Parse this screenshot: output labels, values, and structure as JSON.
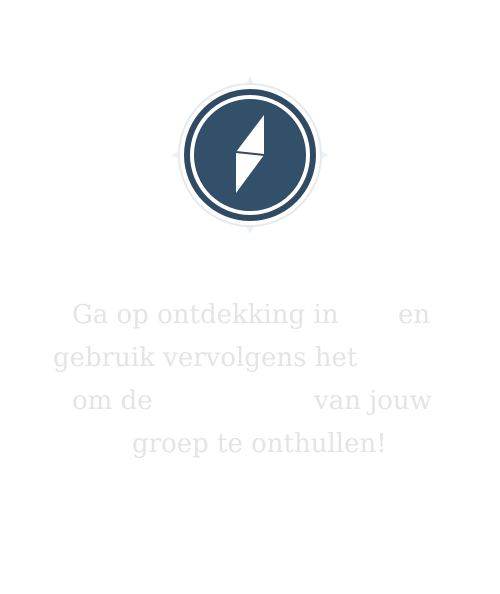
{
  "colors": {
    "background": "#ffffff",
    "compass_disc": "#2f4a62",
    "compass_outer_ring": "#ffffff",
    "compass_shadow": "#e8ecef",
    "needle": "#ffffff",
    "text": "#e4e4e4"
  },
  "icon": {
    "name": "compass-icon"
  },
  "intro": {
    "line1_a": "Ga op ontdekking in",
    "line1_b": "en",
    "line2": "gebruik vervolgens het",
    "line3_a": "om de",
    "line3_b": "van jouw",
    "line4": "groep te onthullen!"
  }
}
